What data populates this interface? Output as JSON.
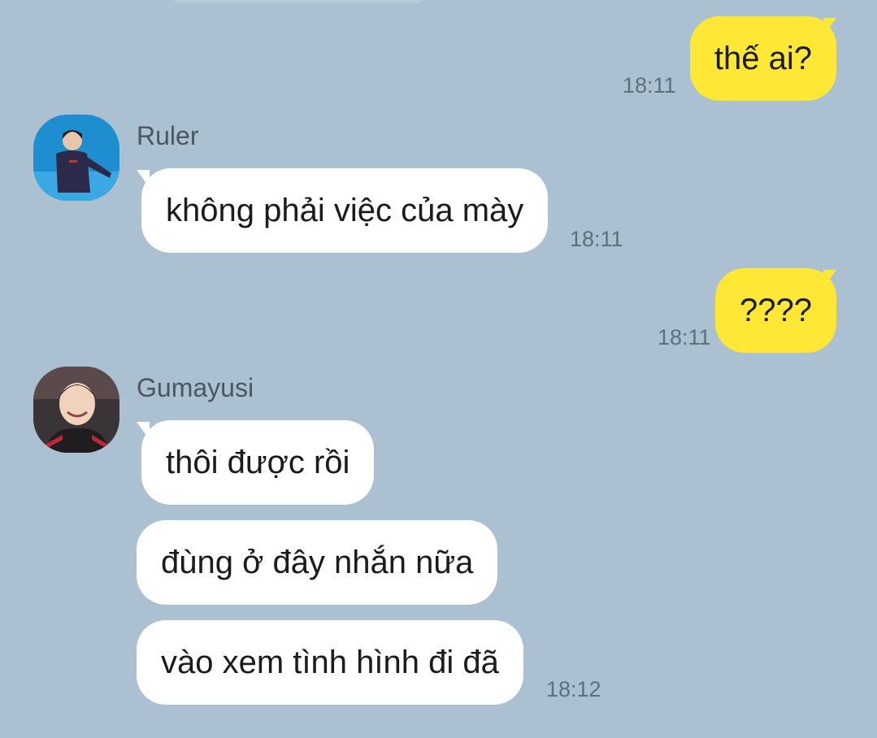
{
  "messages": [
    {
      "direction": "out",
      "text": "thế ai?",
      "time": "18:11"
    },
    {
      "direction": "in",
      "sender": "Ruler",
      "text": "không phải việc của mày",
      "time": "18:11"
    },
    {
      "direction": "out",
      "text": "????",
      "time": "18:11"
    },
    {
      "direction": "in",
      "sender": "Gumayusi",
      "text": "thôi được rồi"
    },
    {
      "direction": "in",
      "text": "đùng ở đây nhắn nữa"
    },
    {
      "direction": "in",
      "text": "vào xem tình hình đi đã",
      "time": "18:12"
    }
  ],
  "colors": {
    "background": "#abc1d1",
    "incoming_bubble": "#ffffff",
    "outgoing_bubble": "#fee835",
    "timestamp": "#5e6f7c",
    "sender_name": "#4a5761"
  }
}
